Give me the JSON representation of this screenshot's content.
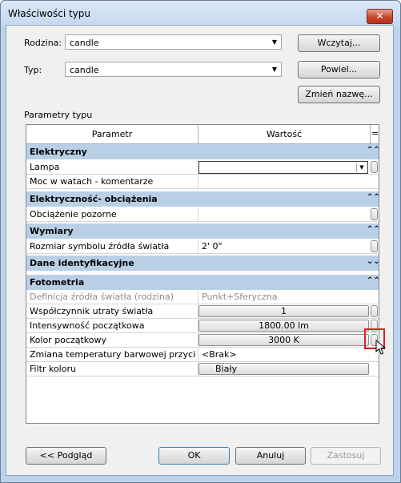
{
  "window": {
    "title": "Właściwości typu",
    "close_label": "✕"
  },
  "fields": {
    "family_label": "Rodzina:",
    "family_value": "candle",
    "type_label": "Typ:",
    "type_value": "candle"
  },
  "side_buttons": {
    "load": "Wczytaj...",
    "duplicate": "Powiel...",
    "rename": "Zmień nazwę..."
  },
  "section_label": "Parametry typu",
  "grid": {
    "col_param": "Parametr",
    "col_value": "Wartość",
    "col_extra": "="
  },
  "groups": [
    {
      "title": "Elektryczny",
      "chevron": "⌃⌃",
      "rows": [
        {
          "name": "Lampa",
          "value": ""
        },
        {
          "name": "Moc w watach - komentarze",
          "value": ""
        }
      ]
    },
    {
      "title": "Elektryczność- obciążenia",
      "chevron": "⌃⌃",
      "rows": [
        {
          "name": "Obciążenie pozorne",
          "value": ""
        }
      ]
    },
    {
      "title": "Wymiary",
      "chevron": "⌃⌃",
      "rows": [
        {
          "name": "Rozmiar symbolu źródła światła",
          "value": "2'  0\""
        }
      ]
    },
    {
      "title": "Dane identyfikacyjne",
      "chevron": "⌄⌄",
      "rows": []
    },
    {
      "title": "Fotometria",
      "chevron": "⌃⌃",
      "rows": [
        {
          "name": "Definicja źródła światła (rodzina)",
          "value": "Punkt+Sferyczna"
        },
        {
          "name": "Współczynnik utraty światła",
          "value": "1"
        },
        {
          "name": "Intensywność początkowa",
          "value": "1800.00 lm"
        },
        {
          "name": "Kolor początkowy",
          "value": "3000 K"
        },
        {
          "name": "Zmiana temperatury barwowej przycie",
          "value": "<Brak>"
        },
        {
          "name": "Filtr koloru",
          "value": "Biały"
        }
      ]
    }
  ],
  "footer": {
    "preview": "<< Podgląd",
    "ok": "OK",
    "cancel": "Anuluj",
    "apply": "Zastosuj"
  },
  "colors": {
    "group_header": "#b9cfe6",
    "highlight": "#e02020",
    "close_button": "#c8442c"
  }
}
